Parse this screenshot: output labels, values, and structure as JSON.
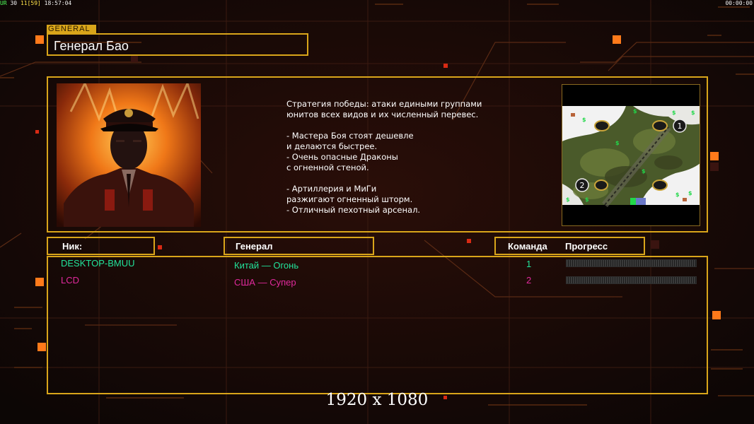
{
  "status": {
    "left_tag": "UR",
    "fps": "30",
    "fps_detail": "11[59]",
    "time": "18:57:04",
    "right_time": "00:00:00"
  },
  "general": {
    "tag": "GENERAL",
    "name": "Генерал Бао",
    "description_lines": [
      "Стратегия победы: атаки едиными группами",
      "юнитов всех видов и их численный перевес.",
      "",
      "- Мастера Боя стоят дешевле",
      "и делаются быстрее.",
      "- Очень опасные Драконы",
      "с огненной стеной.",
      "",
      "- Артиллерия и МиГи",
      "разжигают огненный шторм.",
      "- Отличный пехотный арсенал."
    ]
  },
  "map": {
    "spawn_1": "1",
    "spawn_2": "2",
    "money_symbol": "$"
  },
  "headers": {
    "nick": "Ник:",
    "general": "Генерал",
    "team": "Команда",
    "progress": "Прогресс"
  },
  "players": [
    {
      "nick": "DESKTOP-BMUU",
      "general": "Китай — Огонь",
      "team": "1",
      "color": "#22e39a",
      "progress": 0
    },
    {
      "nick": "LCD",
      "general": "США — Супер",
      "team": "2",
      "color": "#e02a9c",
      "progress": 0
    }
  ],
  "resolution": "1920 x 1080",
  "colors": {
    "gold": "#d9a51a",
    "accent": "#ff7a1a"
  }
}
